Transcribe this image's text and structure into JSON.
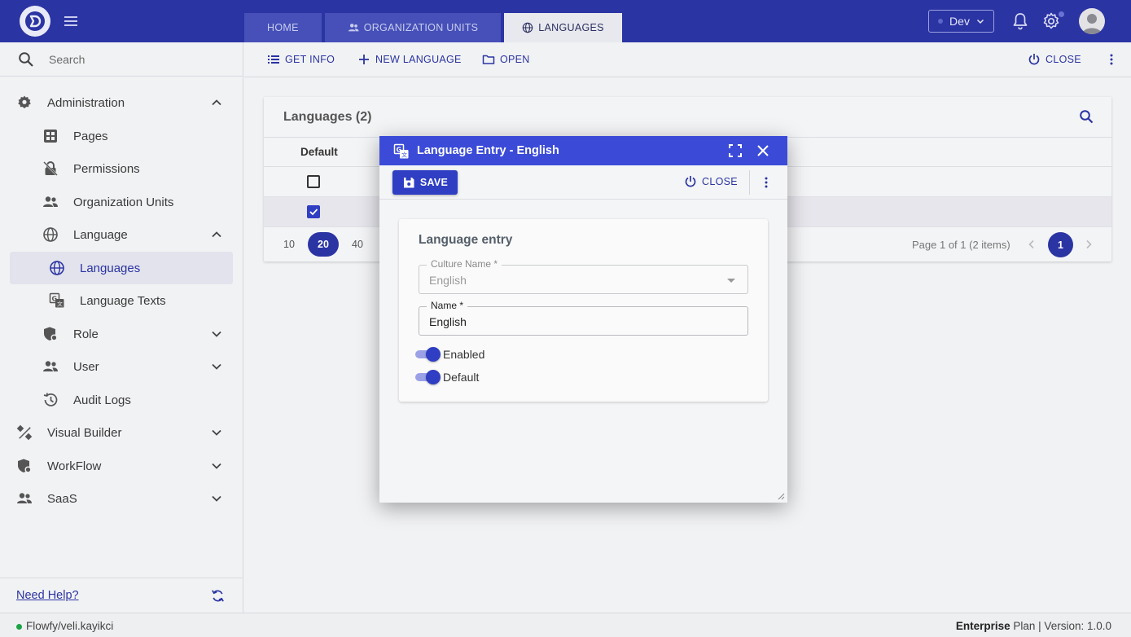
{
  "header": {
    "tabs": [
      {
        "label": "HOME",
        "active": false
      },
      {
        "label": "ORGANIZATION UNITS",
        "active": false
      },
      {
        "label": "LANGUAGES",
        "active": true
      }
    ],
    "env_label": "Dev"
  },
  "sidebar": {
    "search_placeholder": "Search",
    "items": [
      {
        "label": "Administration",
        "icon": "gear-icon",
        "level": 0,
        "expandable": true,
        "expanded": true
      },
      {
        "label": "Pages",
        "icon": "pages-icon",
        "level": 1
      },
      {
        "label": "Permissions",
        "icon": "lock-icon",
        "level": 1
      },
      {
        "label": "Organization Units",
        "icon": "people-icon",
        "level": 1
      },
      {
        "label": "Language",
        "icon": "globe-icon",
        "level": 1,
        "expandable": true,
        "expanded": true
      },
      {
        "label": "Languages",
        "icon": "globe-icon",
        "level": 2,
        "selected": true
      },
      {
        "label": "Language Texts",
        "icon": "translate-icon",
        "level": 2
      },
      {
        "label": "Role",
        "icon": "role-shield-icon",
        "level": 1,
        "expandable": true,
        "expanded": false
      },
      {
        "label": "User",
        "icon": "people-icon",
        "level": 1,
        "expandable": true,
        "expanded": false
      },
      {
        "label": "Audit Logs",
        "icon": "history-icon",
        "level": 1
      },
      {
        "label": "Visual Builder",
        "icon": "design-tools-icon",
        "level": 0,
        "expandable": true,
        "expanded": false
      },
      {
        "label": "WorkFlow",
        "icon": "workflow-shield-icon",
        "level": 0,
        "expandable": true,
        "expanded": false
      },
      {
        "label": "SaaS",
        "icon": "people-icon",
        "level": 0,
        "expandable": true,
        "expanded": false
      }
    ],
    "help_label": "Need Help?"
  },
  "toolbar": {
    "get_info": "GET INFO",
    "new_language": "NEW LANGUAGE",
    "open": "OPEN",
    "close": "CLOSE"
  },
  "grid": {
    "title": "Languages (2)",
    "columns": [
      "Default"
    ],
    "rows": [
      {
        "default": false
      },
      {
        "default": true
      }
    ],
    "page_sizes": [
      "10",
      "20",
      "40"
    ],
    "active_page_size": "20",
    "page_info": "Page 1 of 1 (2 items)",
    "current_page": "1"
  },
  "dialog": {
    "title": "Language Entry - English",
    "save_label": "SAVE",
    "close_label": "CLOSE",
    "form": {
      "title": "Language entry",
      "culture_name_label": "Culture Name *",
      "culture_name_value": "English",
      "name_label": "Name *",
      "name_value": "English",
      "enabled_label": "Enabled",
      "enabled": true,
      "default_label": "Default",
      "default": true
    }
  },
  "status": {
    "user": "Flowfy/veli.kayikci",
    "plan_bold": "Enterprise",
    "plan_rest": " Plan | Version: 1.0.0"
  },
  "colors": {
    "primary": "#2b34a3",
    "dialog_header": "#3b4bd8",
    "online": "#1ba345"
  }
}
